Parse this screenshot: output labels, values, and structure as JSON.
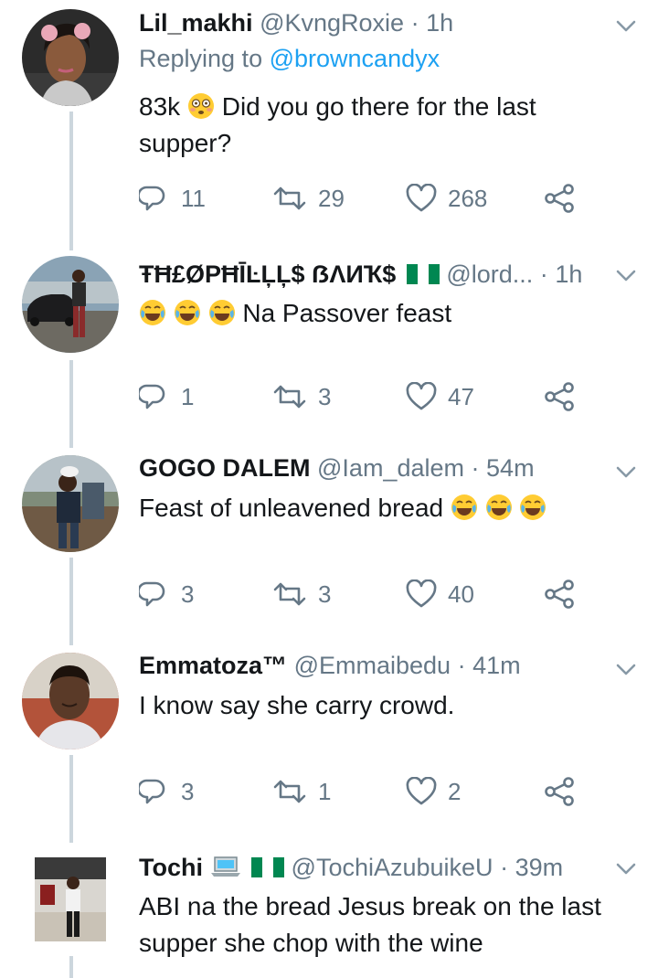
{
  "tweets": [
    {
      "name": "Lil_makhi",
      "handle": "@KvngRoxie",
      "time": "1h",
      "replying_prefix": "Replying to",
      "replying_to": "@browncandyx",
      "text_prefix": "83k",
      "text_after": "Did you go there for the last",
      "text_line2": "supper?",
      "replies": "11",
      "retweets": "29",
      "likes": "268"
    },
    {
      "name": "ŦĦ£ØPĦĪĿĻĻ$ ẞΛИҠ$",
      "handle": "@lord...",
      "time": "1h",
      "text": "Na Passover feast",
      "replies": "1",
      "retweets": "3",
      "likes": "47"
    },
    {
      "name": "GOGO DALEM",
      "handle": "@Iam_dalem",
      "time": "54m",
      "text": "Feast of unleavened bread",
      "replies": "3",
      "retweets": "3",
      "likes": "40"
    },
    {
      "name": "Emmatoza™",
      "handle": "@Emmaibedu",
      "time": "41m",
      "text": "I know say she carry crowd.",
      "replies": "3",
      "retweets": "1",
      "likes": "2"
    },
    {
      "name": "Tochi",
      "handle": "@TochiAzubuikeU",
      "time": "39m",
      "text_line1": "ABI na the bread Jesus break on the last",
      "text_line2": "supper she chop with the wine"
    }
  ],
  "separator": "·",
  "icons": {
    "reply": "reply-icon",
    "retweet": "retweet-icon",
    "like": "heart-icon",
    "share": "share-icon",
    "menu": "chevron-down-icon",
    "emoji_flushed": "flushed-face-emoji",
    "emoji_joy": "tears-of-joy-emoji",
    "flag": "nigeria-flag-icon",
    "laptop": "laptop-emoji"
  },
  "colors": {
    "text": "#14171a",
    "secondary": "#657786",
    "link": "#1da1f2",
    "thread_line": "#ccd6dd",
    "flag_green": "#008751"
  }
}
